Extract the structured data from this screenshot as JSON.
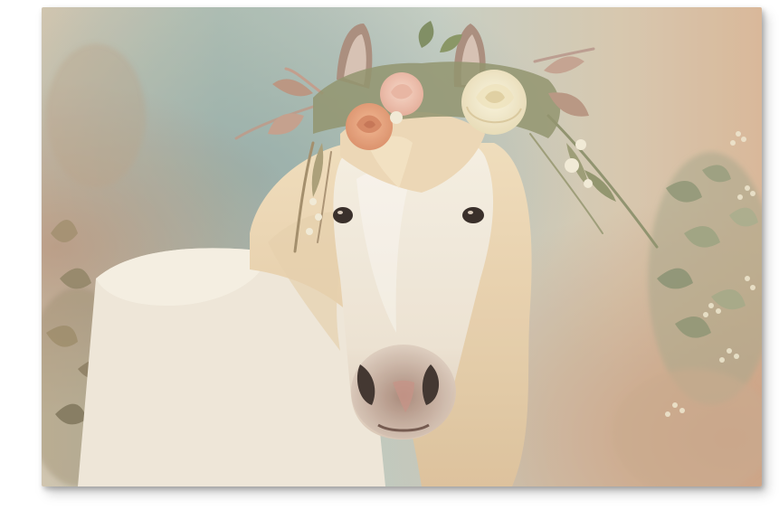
{
  "scene": {
    "subject": "white-horse-with-flower-crown",
    "palette": {
      "background_sky": "#c9cfc4",
      "background_teal": "#9fb3ad",
      "background_warm": "#d9b99a",
      "horse_coat": "#efe6d6",
      "mane": "#e8d2b0",
      "muzzle": "#8a6d62",
      "rose_cream": "#f3ead0",
      "rose_peach": "#e7a07a",
      "rose_pink": "#eec2ae",
      "foliage": "#8c8f6a",
      "dry_grass": "#b88a78"
    }
  }
}
